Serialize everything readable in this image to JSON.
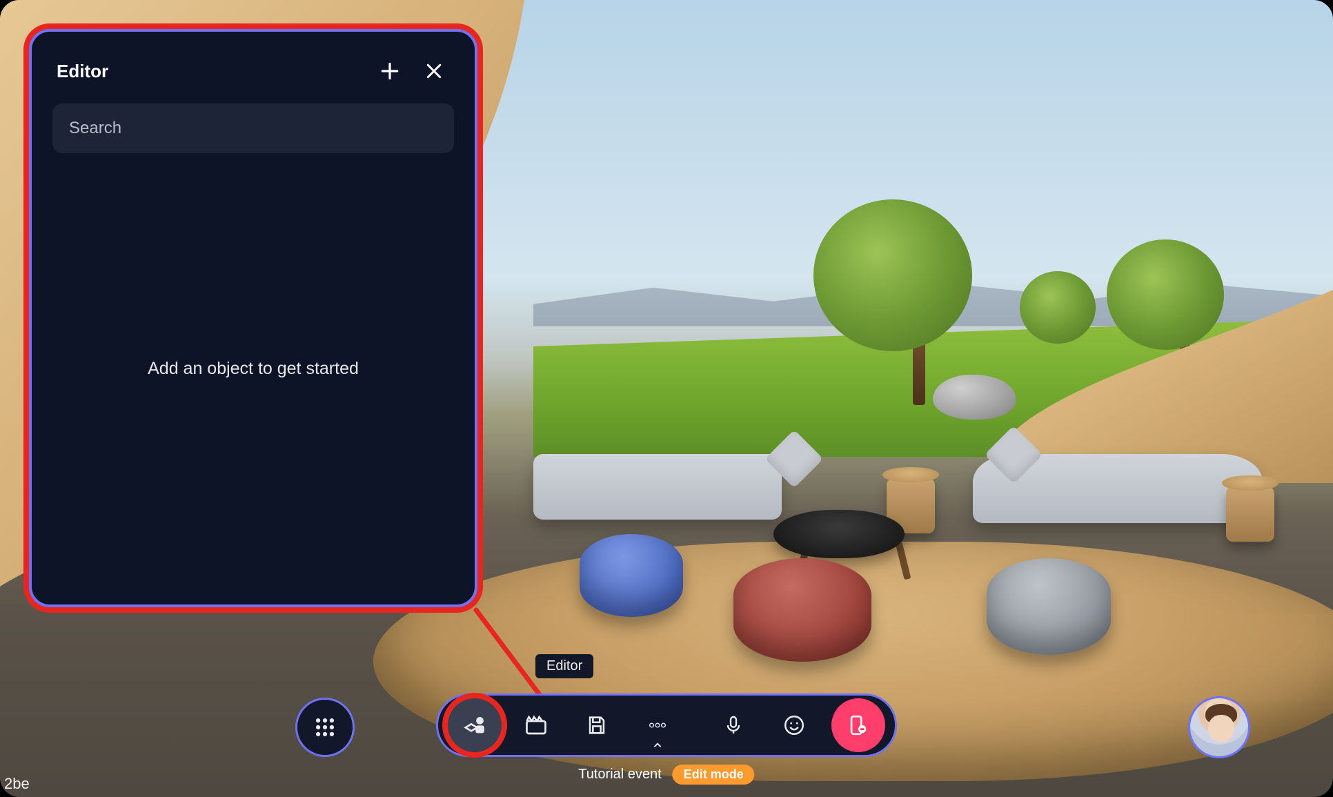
{
  "editor": {
    "title": "Editor",
    "search_placeholder": "Search",
    "empty_message": "Add an object to get started"
  },
  "tooltip": {
    "editor": "Editor"
  },
  "toolbar": {
    "items": [
      {
        "name": "editor",
        "icon": "object-pieces-icon",
        "active": true
      },
      {
        "name": "clapper",
        "icon": "clapperboard-icon"
      },
      {
        "name": "save",
        "icon": "save-icon"
      },
      {
        "name": "more",
        "icon": "ellipsis-icon",
        "has_caret": true
      },
      {
        "name": "mic",
        "icon": "microphone-icon"
      },
      {
        "name": "emoji",
        "icon": "smiley-icon"
      },
      {
        "name": "leave",
        "icon": "leave-icon",
        "variant": "leave"
      }
    ]
  },
  "status": {
    "event_name": "Tutorial event",
    "mode_badge": "Edit mode"
  },
  "watermark": "2be",
  "colors": {
    "panel_bg": "#0e1427",
    "accent_border": "#6e72ff",
    "callout_ring": "#e7261f",
    "leave_bg": "#ff3e6b",
    "badge_bg": "#ff9a2e"
  }
}
